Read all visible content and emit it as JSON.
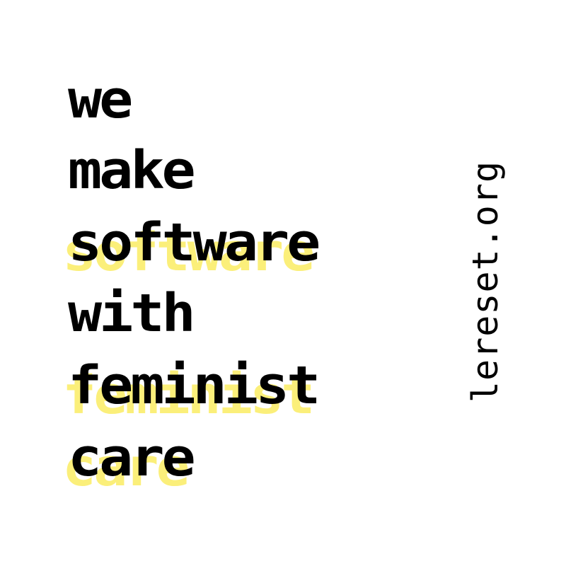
{
  "lines": [
    {
      "text": "we",
      "highlighted": false
    },
    {
      "text": "make",
      "highlighted": false
    },
    {
      "text": "software",
      "highlighted": true
    },
    {
      "text": "with",
      "highlighted": false
    },
    {
      "text": "feminist",
      "highlighted": true
    },
    {
      "text": "care",
      "highlighted": true
    }
  ],
  "website": "lereset.org",
  "colors": {
    "background": "#ffffff",
    "text": "#000000",
    "highlight_shadow": "#fbef7a"
  }
}
